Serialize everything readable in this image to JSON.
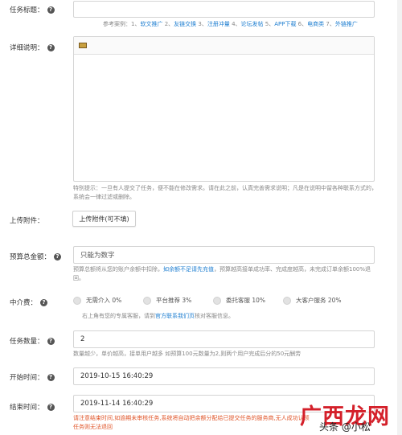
{
  "form": {
    "title_label": "任务标题：",
    "title_examples": {
      "prefix": "参考案例：1、",
      "items": [
        {
          "num": "",
          "text": "软文推广",
          "sep": " 2、"
        },
        {
          "num": "",
          "text": "友链交换",
          "sep": " 3、"
        },
        {
          "num": "",
          "text": "注册冲量",
          "sep": " 4、"
        },
        {
          "num": "",
          "text": "论坛发帖",
          "sep": " 5、"
        },
        {
          "num": "",
          "text": "APP下载",
          "sep": " 6、"
        },
        {
          "num": "",
          "text": "电商类",
          "sep": " 7、"
        },
        {
          "num": "",
          "text": "外链推广",
          "sep": ""
        }
      ]
    },
    "detail_label": "详细说明：",
    "detail_hint": "特别提示：一旦有人提交了任务，便不能在修改需求。请在此之前，认真完善需求说明；凡是在说明中留各种联系方式的，系统会一律过滤或删除。",
    "upload_label": "上传附件：",
    "upload_button": "上传附件(可不填)",
    "budget_label": "预算总金额：",
    "budget_placeholder": "只能为数字",
    "budget_hint_1": "预算总额将从您的账户余额中扣除，",
    "budget_hint_link": "如余额不足请先充值",
    "budget_hint_2": "，预算越高接单成功率、完成度越高，未完成订单余额100%退回。",
    "agent_label": "中介费：",
    "agent_options": [
      {
        "label": "无需介入 0%"
      },
      {
        "label": "平台推荐 3%"
      },
      {
        "label": "委托客服 10%"
      },
      {
        "label": "大客户服务 20%"
      }
    ],
    "agent_hint_1": "右上角有您的专属客服，请到",
    "agent_hint_link": "官方联系我们页",
    "agent_hint_2": "核对客服信息。",
    "count_label": "任务数量：",
    "count_value": "2",
    "count_hint": "数量越少，单价越高，接单用户越多 如预算100元数量为2,则两个用户完成后分的50元酬劳",
    "start_label": "开始时间：",
    "start_value": "2019-10-15 16:40:29",
    "end_label": "结束时间：",
    "end_value": "2019-11-14 16:40:29",
    "end_warning": "请注意结束时间,如逾期未审核任务,系统将自动把余额分配给已提交任务的服务商,无人成功认领任务则无法退回"
  },
  "watermark": {
    "brand": "广西龙网",
    "sub": "头条 @小松"
  },
  "colors": {
    "link": "#1f7fd1",
    "warning": "#e0562a",
    "watermark": "#d4202a"
  }
}
